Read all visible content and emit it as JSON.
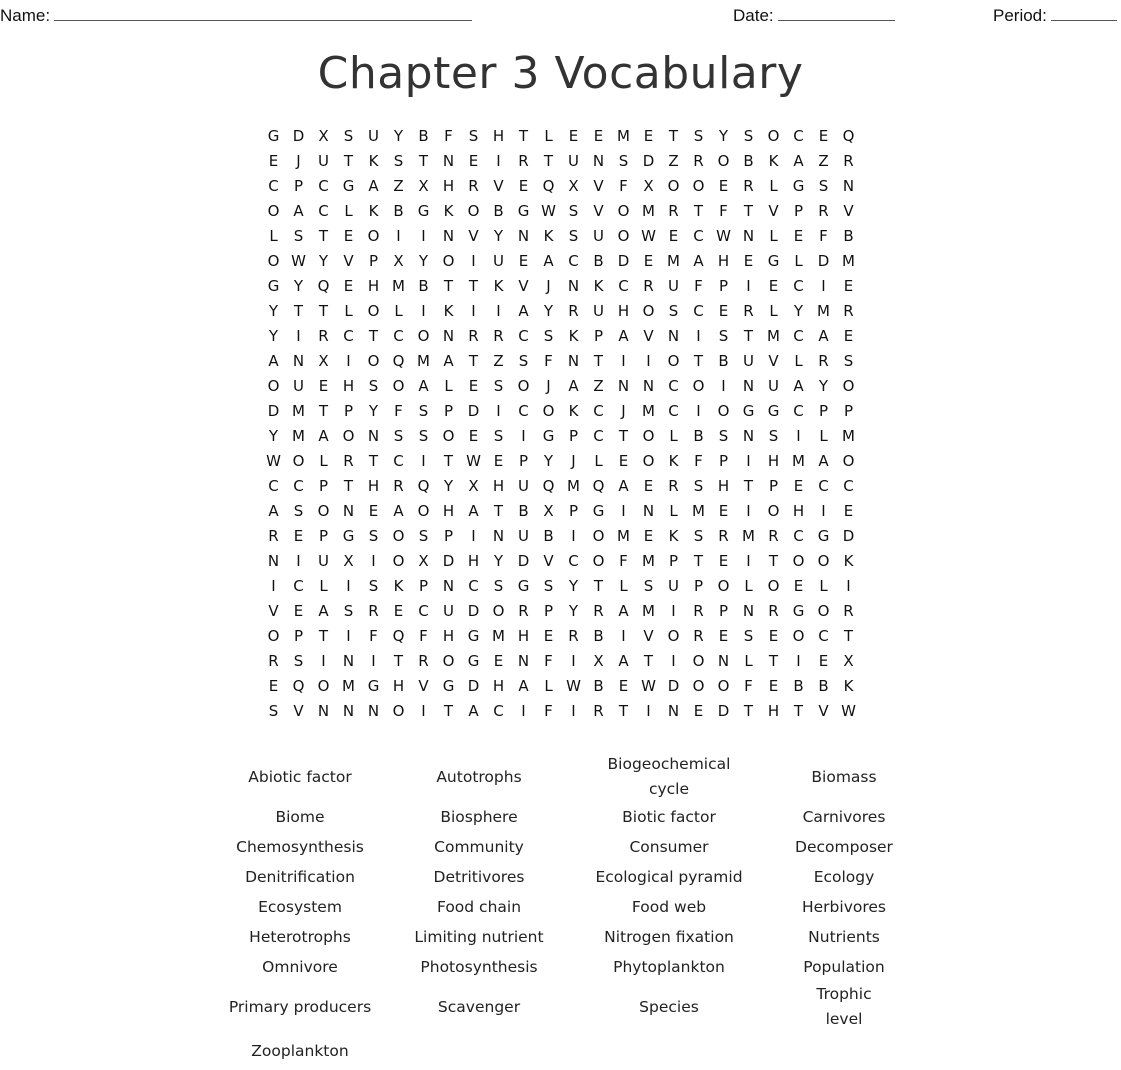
{
  "header": {
    "name_label": "Name:",
    "date_label": "Date:",
    "period_label": "Period:"
  },
  "title": "Chapter 3 Vocabulary",
  "grid": [
    "GDXSUYBFSHTLEEMETSYSOCEQ",
    "EJUTKSTNEIRTUNSDZROBKAZR",
    "CPCGAZXHRVEQXVFXOOERLGSN",
    "OACLKBGKOBGWSVOMRTFTVPRV",
    "LSTEOIINVYNKSUOWECWNLEFB",
    "OWYVPXYOIUEACBDEMAHEGLDM",
    "GYQEHMBTTKVJNKCRUFPIECIE",
    "YTTLOLIKIIAYRUHOSCERLYMR",
    "YIRCTCONRRCSKPAVNISTMCAE",
    "ANXIOQMATZSFNTIIOTBUVLRS",
    "OUEHSOALESOJAZNNCOINUAYO",
    "DMTPYFSPDICOKCJMCIOGGCPP",
    "YMAONSSOESIGPCTOLBSNSILM",
    "WOLRTCITWEPYJLEOKFPIHMAO",
    "CCPTHRQYXHUQMQAERSHTPECC",
    "ASONEAOHATBXPGINLMEIOHIE",
    "REPGSOSPINUBIOMEKSRMRCGD",
    "NIUXIOXDHYDVCOFMPTEITOOK",
    "ICLISKPNCSGSYTLSUPOLOELI",
    "VEASRECUDORPYRAMIRPNRGOR",
    "OPTIFQFHGMHERBIVORESEOCT",
    "RSINITROGENFIXATIONLTIEX",
    "EQOMGHVGDHALWBEWDOOFEBBK",
    "SVNNNOITACIFIRTINEDTHTVW"
  ],
  "word_rows": [
    [
      "Abiotic factor",
      "Autotrophs",
      "Biogeochemical cycle",
      "Biomass"
    ],
    [
      "Biome",
      "Biosphere",
      "Biotic factor",
      "Carnivores"
    ],
    [
      "Chemosynthesis",
      "Community",
      "Consumer",
      "Decomposer"
    ],
    [
      "Denitrification",
      "Detritivores",
      "Ecological pyramid",
      "Ecology"
    ],
    [
      "Ecosystem",
      "Food chain",
      "Food web",
      "Herbivores"
    ],
    [
      "Heterotrophs",
      "Limiting nutrient",
      "Nitrogen fixation",
      "Nutrients"
    ],
    [
      "Omnivore",
      "Photosynthesis",
      "Phytoplankton",
      "Population"
    ],
    [
      "Primary producers",
      "Scavenger",
      "Species",
      "Trophic level"
    ],
    [
      "Zooplankton"
    ]
  ]
}
